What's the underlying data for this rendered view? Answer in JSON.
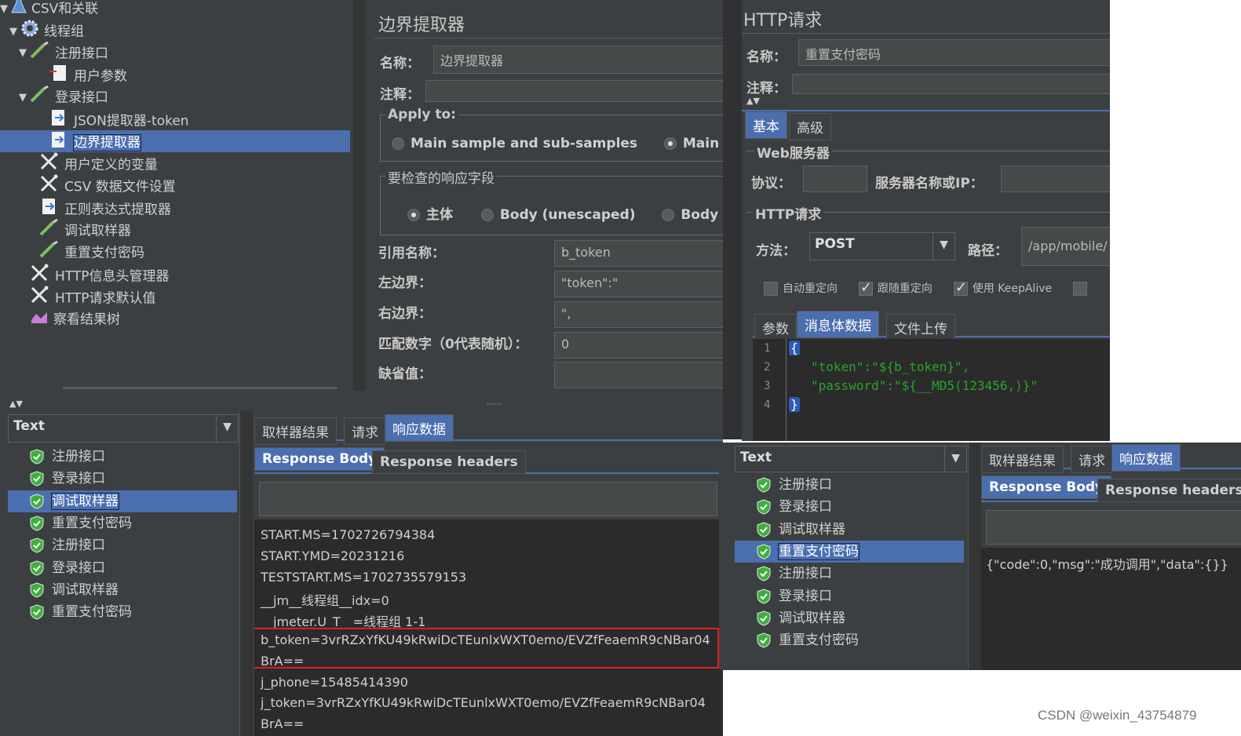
{
  "tree": {
    "items": [
      {
        "label": "CSV和关联",
        "icon": "flask-icon",
        "arrow": "▼"
      },
      {
        "label": "线程组",
        "icon": "gear-icon",
        "arrow": "▼"
      },
      {
        "label": "注册接口",
        "icon": "pipette-icon",
        "arrow": "▼"
      },
      {
        "label": "用户参数",
        "icon": "doc-icon",
        "arrow": ""
      },
      {
        "label": "登录接口",
        "icon": "pipette-icon",
        "arrow": "▼"
      },
      {
        "label": "JSON提取器-token",
        "icon": "extractor-icon",
        "arrow": ""
      },
      {
        "label": "边界提取器",
        "icon": "extractor-icon",
        "arrow": ""
      },
      {
        "label": "用户定义的变量",
        "icon": "wrench-icon",
        "arrow": ""
      },
      {
        "label": "CSV 数据文件设置",
        "icon": "wrench-icon",
        "arrow": ""
      },
      {
        "label": "正则表达式提取器",
        "icon": "extractor-icon",
        "arrow": ""
      },
      {
        "label": "调试取样器",
        "icon": "pipette-icon",
        "arrow": ""
      },
      {
        "label": "重置支付密码",
        "icon": "pipette-icon",
        "arrow": ""
      },
      {
        "label": "HTTP信息头管理器",
        "icon": "wrench-icon",
        "arrow": ""
      },
      {
        "label": "HTTP请求默认值",
        "icon": "wrench-icon",
        "arrow": ""
      },
      {
        "label": "察看结果树",
        "icon": "chart-icon",
        "arrow": ""
      }
    ]
  },
  "boundary": {
    "title": "边界提取器",
    "name_label": "名称：",
    "name_value": "边界提取器",
    "comment_label": "注释：",
    "apply_to": "Apply to:",
    "apply_opt1": "Main sample and sub-samples",
    "apply_opt2": "Main sam",
    "field_section": "要检查的响应字段",
    "field_opt1": "主体",
    "field_opt2": "Body (unescaped)",
    "field_opt3": "Body as",
    "ref_label": "引用名称：",
    "ref_value": "b_token",
    "left_label": "左边界：",
    "left_value": "\"token\":\"",
    "right_label": "右边界：",
    "right_value": "\",",
    "match_label": "匹配数字（0代表随机）：",
    "match_value": "0",
    "default_label": "缺省值："
  },
  "http": {
    "title": "HTTP请求",
    "name_label": "名称：",
    "name_value": "重置支付密码",
    "comment_label": "注释：",
    "tab_basic": "基本",
    "tab_advanced": "高级",
    "web_server": "Web服务器",
    "protocol_label": "协议：",
    "server_label": "服务器名称或IP：",
    "http_section": "HTTP请求",
    "method_label": "方法：",
    "method_value": "POST",
    "path_label": "路径：",
    "path_value": "/app/mobile/",
    "cb_redirect": "自动重定向",
    "cb_follow": "跟随重定向",
    "cb_keepalive": "使用 KeepAlive",
    "tab_params": "参数",
    "tab_body": "消息体数据",
    "tab_upload": "文件上传",
    "code_lines": [
      {
        "n": "1",
        "text": "{"
      },
      {
        "n": "2",
        "text": "  \"token\":\"${b_token}\","
      },
      {
        "n": "3",
        "text": "  \"password\":\"${__MD5(123456,)}\""
      },
      {
        "n": "4",
        "text": "}"
      }
    ]
  },
  "results_left": {
    "combo": "Text",
    "tab_sampler": "取样器结果",
    "tab_request": "请求",
    "tab_response": "响应数据",
    "sub_body": "Response Body",
    "sub_headers": "Response headers",
    "items": [
      "注册接口",
      "登录接口",
      "调试取样器",
      "重置支付密码",
      "注册接口",
      "登录接口",
      "调试取样器",
      "重置支付密码"
    ],
    "lines": [
      "START.MS=1702726794384",
      "START.YMD=20231216",
      "TESTSTART.MS=1702735579153",
      "__jm__线程组__idx=0",
      "__jmeter.U_T__=线程组 1-1",
      "b_token=3vrRZxYfKU49kRwiDcTEunlxWXT0emo/EVZfFeaemR9cNBar04",
      "BrA==",
      "j_phone=15485414390",
      "j_token=3vrRZxYfKU49kRwiDcTEunlxWXT0emo/EVZfFeaemR9cNBar04",
      "BrA=="
    ]
  },
  "results_right": {
    "combo": "Text",
    "tab_sampler": "取样器结果",
    "tab_request": "请求",
    "tab_response": "响应数据",
    "sub_body": "Response Body",
    "sub_headers": "Response headers",
    "items": [
      "注册接口",
      "登录接口",
      "调试取样器",
      "重置支付密码",
      "注册接口",
      "登录接口",
      "调试取样器",
      "重置支付密码"
    ],
    "response": "{\"code\":0,\"msg\":\"成功调用\",\"data\":{}}"
  },
  "watermark": "CSDN @weixin_43754879",
  "colors": {
    "bg": "#3c3f41",
    "selected": "#4b6eaf",
    "highlight_box": "#e02020",
    "code_green": "#28a428"
  }
}
